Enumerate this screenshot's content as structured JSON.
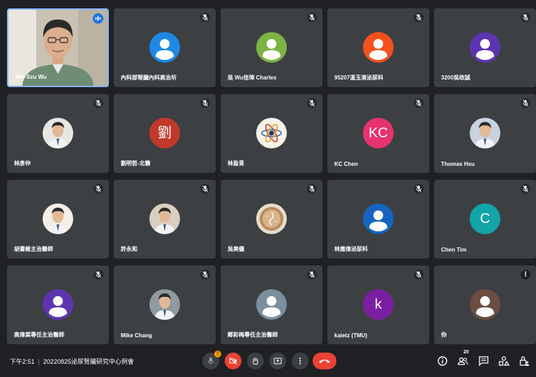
{
  "participants": [
    {
      "name": "Mai-Szu Wu",
      "speaking": true,
      "video": true
    },
    {
      "name": "內科部腎臟內科高治圻",
      "avatar": "person",
      "color": "#1e88e5"
    },
    {
      "name": "吳 Wu佳璋 Charles",
      "avatar": "person",
      "color": "#7cb342"
    },
    {
      "name": "95207溫玉清泌尿科",
      "avatar": "person",
      "color": "#f4511e"
    },
    {
      "name": "3200吳政誠",
      "avatar": "person",
      "color": "#5e35b1"
    },
    {
      "name": "林彥仲",
      "avatar": "photo",
      "color": "#e8e6e3"
    },
    {
      "name": "劉明哲-北醫",
      "avatar": "letter",
      "letter": "劉",
      "color": "#c0392b"
    },
    {
      "name": "林盈青",
      "avatar": "atom",
      "color": "#f7f3ea"
    },
    {
      "name": "KC Chen",
      "avatar": "letter",
      "letter": "KC",
      "color": "#e5336d"
    },
    {
      "name": "Thomas Hsu",
      "avatar": "photo",
      "color": "#c9d3e0"
    },
    {
      "name": "胡書維主治醫師",
      "avatar": "photo",
      "color": "#f4eee6"
    },
    {
      "name": "許永和",
      "avatar": "photo",
      "color": "#d9cfc1"
    },
    {
      "name": "吳美儀",
      "avatar": "coffee",
      "color": "#b78a5e"
    },
    {
      "name": "林應偉泌尿科",
      "avatar": "person",
      "color": "#1565c0"
    },
    {
      "name": "Chen Tim",
      "avatar": "letter",
      "letter": "C",
      "color": "#12a4a6"
    },
    {
      "name": "高偉棠專任主治醫師",
      "avatar": "person",
      "color": "#5e35b1"
    },
    {
      "name": "Mike Chang",
      "avatar": "photo",
      "color": "#8f9aa0"
    },
    {
      "name": "鄭彩梅專任主治醫師",
      "avatar": "person",
      "color": "#78909c"
    },
    {
      "name": "kaietz (TMU)",
      "avatar": "letter",
      "letter": "k",
      "color": "#7b1fa2"
    },
    {
      "name": "你",
      "avatar": "person",
      "color": "#6d4c41",
      "alert": true
    }
  ],
  "bottom_bar": {
    "time": "下午2:51",
    "meeting_title": "20220825泌尿腎臟研究中心例會",
    "mic_badge": "!",
    "participant_count": "20"
  },
  "colors": {
    "background": "#202124",
    "tile": "#3c4043",
    "leave": "#ea4335",
    "active_border": "#8ab4f8",
    "badge": "#f29900"
  }
}
